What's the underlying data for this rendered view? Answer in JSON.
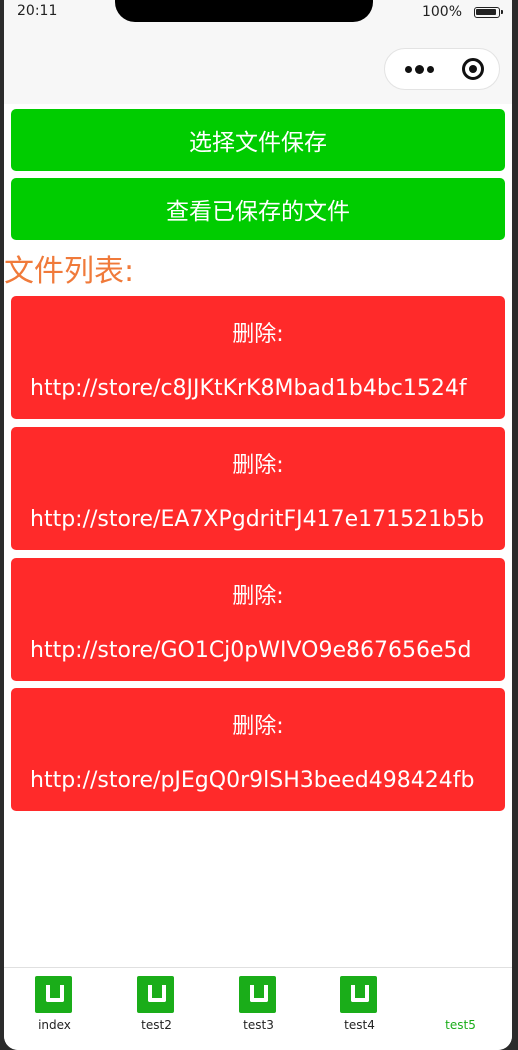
{
  "status_bar": {
    "time": "20:11",
    "battery": "100%"
  },
  "nav_bar": {
    "more_icon": "more-dots-icon",
    "close_icon": "record-circle-icon"
  },
  "buttons": {
    "choose_file": "选择文件保存",
    "view_saved": "查看已保存的文件"
  },
  "file_list": {
    "title": "文件列表:",
    "items": [
      {
        "delete_label": "删除:",
        "url": "http://store/c8JJKtKrK8Mbad1b4bc1524f"
      },
      {
        "delete_label": "删除:",
        "url": "http://store/EA7XPgdritFJ417e171521b5b"
      },
      {
        "delete_label": "删除:",
        "url": "http://store/GO1Cj0pWIVO9e867656e5d"
      },
      {
        "delete_label": "删除:",
        "url": "http://store/pJEgQ0r9lSH3beed498424fb"
      }
    ]
  },
  "tab_bar": {
    "tabs": [
      {
        "label": "index",
        "icon": "miniapp-tab-icon",
        "active": false
      },
      {
        "label": "test2",
        "icon": "miniapp-tab-icon",
        "active": false
      },
      {
        "label": "test3",
        "icon": "miniapp-tab-icon",
        "active": false
      },
      {
        "label": "test4",
        "icon": "miniapp-tab-icon",
        "active": false
      },
      {
        "label": "test5",
        "icon": "",
        "active": true
      }
    ]
  },
  "colors": {
    "primary_button": "#00cc00",
    "delete_button": "#ff2a2a",
    "list_title": "#f07a3a",
    "tab_active": "#1aad19"
  }
}
